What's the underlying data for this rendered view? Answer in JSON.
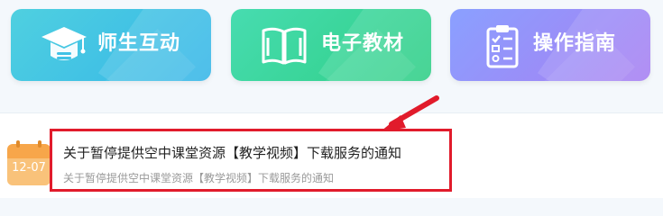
{
  "tiles": [
    {
      "label": "师生互动",
      "icon": "graduation-cap-icon"
    },
    {
      "label": "电子教材",
      "icon": "open-book-icon"
    },
    {
      "label": "操作指南",
      "icon": "clipboard-checklist-icon"
    }
  ],
  "notice": {
    "date": "12-07",
    "title": "关于暂停提供空中课堂资源【教学视频】下载服务的通知",
    "subtitle": "关于暂停提供空中课堂资源【教学视频】下载服务的通知"
  },
  "colors": {
    "tile1": "#36b6e8",
    "tile2": "#2fcf86",
    "tile3": "#a77ff2",
    "highlight": "#e11b2b",
    "calendar": "#f7a64a"
  }
}
